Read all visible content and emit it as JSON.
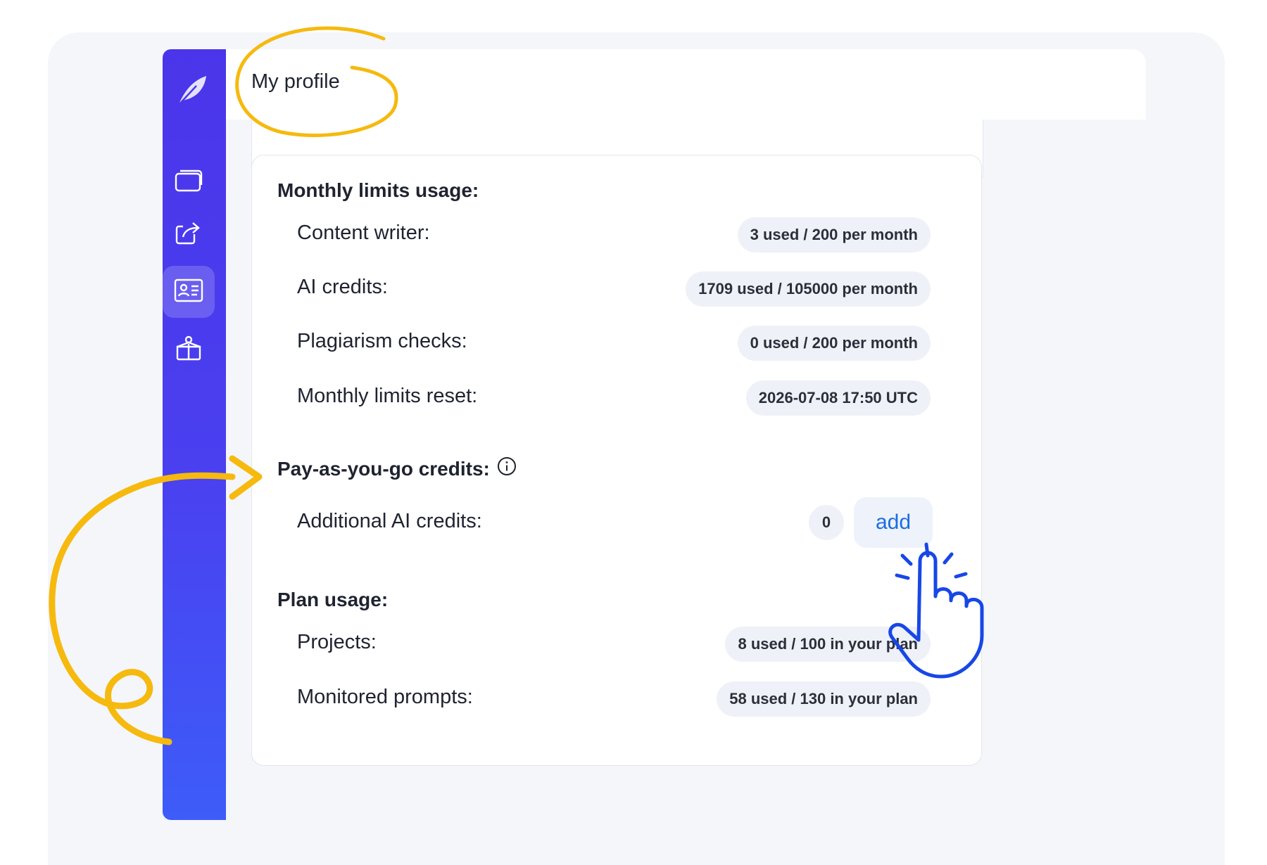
{
  "header": {
    "title": "My profile"
  },
  "sidebar": {
    "items": [
      {
        "name": "logo",
        "icon": "feather-icon"
      },
      {
        "name": "projects",
        "icon": "folders-icon"
      },
      {
        "name": "share",
        "icon": "share-icon"
      },
      {
        "name": "profile",
        "icon": "id-card-icon",
        "active": true
      },
      {
        "name": "gift",
        "icon": "gift-box-icon"
      }
    ]
  },
  "monthly": {
    "title": "Monthly limits usage:",
    "rows": [
      {
        "label": "Content writer:",
        "value": "3 used / 200 per month"
      },
      {
        "label": "AI credits:",
        "value": "1709 used / 105000 per month"
      },
      {
        "label": "Plagiarism checks:",
        "value": "0 used / 200 per month"
      },
      {
        "label": "Monthly limits reset:",
        "value": "2026-07-08 17:50 UTC"
      }
    ]
  },
  "payg": {
    "title": "Pay-as-you-go credits:",
    "info_icon": "info-circle-icon",
    "row": {
      "label": "Additional AI credits:",
      "count": "0",
      "add_label": "add"
    }
  },
  "plan": {
    "title": "Plan usage:",
    "rows": [
      {
        "label": "Projects:",
        "value": "8 used / 100 in your plan"
      },
      {
        "label": "Monitored prompts:",
        "value": "58 used / 130 in your plan"
      }
    ]
  },
  "colors": {
    "sidebar_top": "#4b35ea",
    "sidebar_bottom": "#3d5cf8",
    "annotation": "#f6b90e",
    "pointer_hand": "#1747e6",
    "link": "#1a6ee0"
  },
  "annotations": {
    "title_circle": "yellow-circle",
    "arrow": "yellow-curved-arrow",
    "hand": "pointer-hand-icon"
  }
}
